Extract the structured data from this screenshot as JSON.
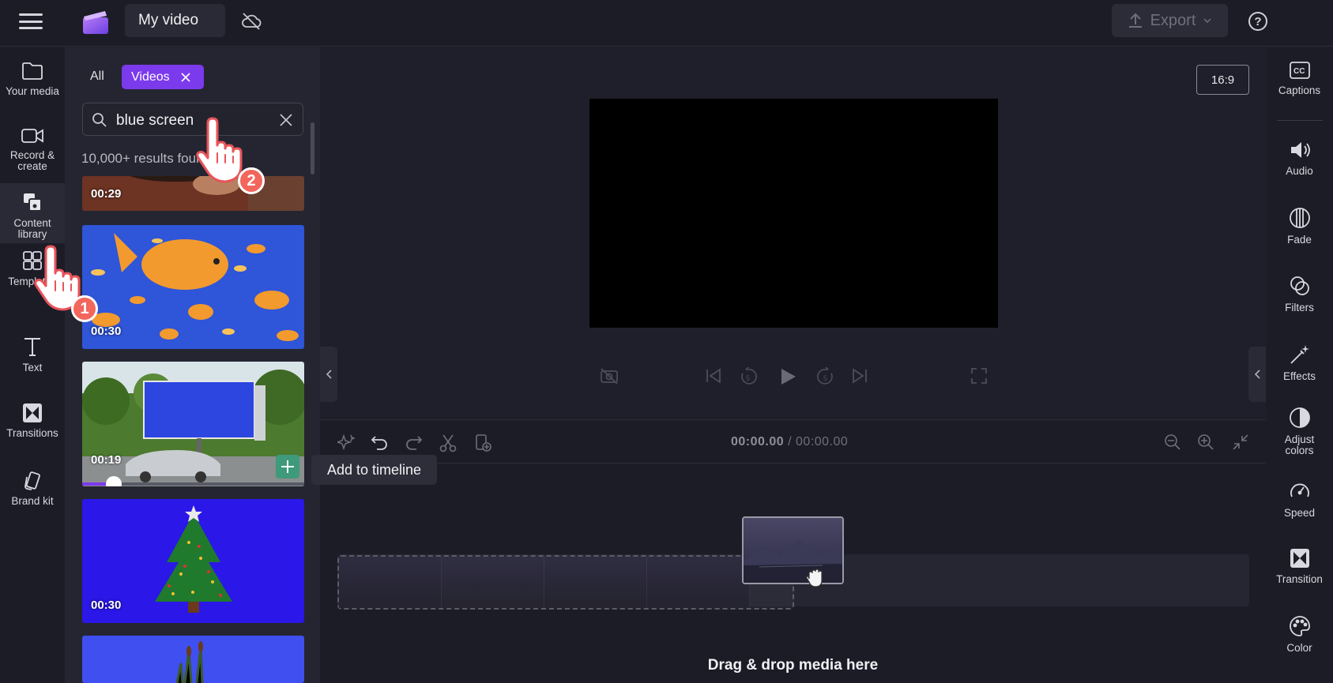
{
  "header": {
    "project_title": "My video",
    "export_label": "Export",
    "help_label": "?"
  },
  "left_rail": {
    "items": [
      {
        "label": "Your media",
        "icon": "folder-icon"
      },
      {
        "label": "Record & create",
        "icon": "camera-icon"
      },
      {
        "label": "Content library",
        "icon": "content-library-icon"
      },
      {
        "label": "Templates",
        "icon": "templates-icon"
      },
      {
        "label": "Text",
        "icon": "text-icon"
      },
      {
        "label": "Transitions",
        "icon": "transitions-icon"
      },
      {
        "label": "Brand kit",
        "icon": "brand-kit-icon"
      }
    ]
  },
  "library": {
    "tab_all": "All",
    "filter_chip": "Videos",
    "search_value": "blue screen",
    "results_text": "10,000+ results found",
    "thumbnails": [
      {
        "duration": "00:29",
        "subject": "hand"
      },
      {
        "duration": "00:30",
        "subject": "goldfish"
      },
      {
        "duration": "00:19",
        "subject": "billboard"
      },
      {
        "duration": "00:30",
        "subject": "christmas-tree"
      },
      {
        "duration": "",
        "subject": "plant"
      }
    ]
  },
  "preview": {
    "aspect_ratio": "16:9"
  },
  "timeline": {
    "current_time": "00:00.00",
    "total_time": "/ 00:00.00",
    "drop_hint": "Drag & drop media here",
    "tooltip": "Add to timeline"
  },
  "right_rail": {
    "items": [
      {
        "label": "Captions",
        "icon": "captions-icon"
      },
      {
        "label": "Audio",
        "icon": "audio-icon"
      },
      {
        "label": "Fade",
        "icon": "fade-icon"
      },
      {
        "label": "Filters",
        "icon": "filters-icon"
      },
      {
        "label": "Effects",
        "icon": "effects-icon"
      },
      {
        "label": "Adjust colors",
        "icon": "adjust-colors-icon"
      },
      {
        "label": "Speed",
        "icon": "speed-icon"
      },
      {
        "label": "Transition",
        "icon": "transition-icon"
      },
      {
        "label": "Color",
        "icon": "color-icon"
      }
    ]
  },
  "annotations": {
    "step1": "1",
    "step2": "2"
  },
  "colors": {
    "accent": "#7c3aed",
    "background": "#1f1f2b",
    "annotation": "#f2665c"
  }
}
